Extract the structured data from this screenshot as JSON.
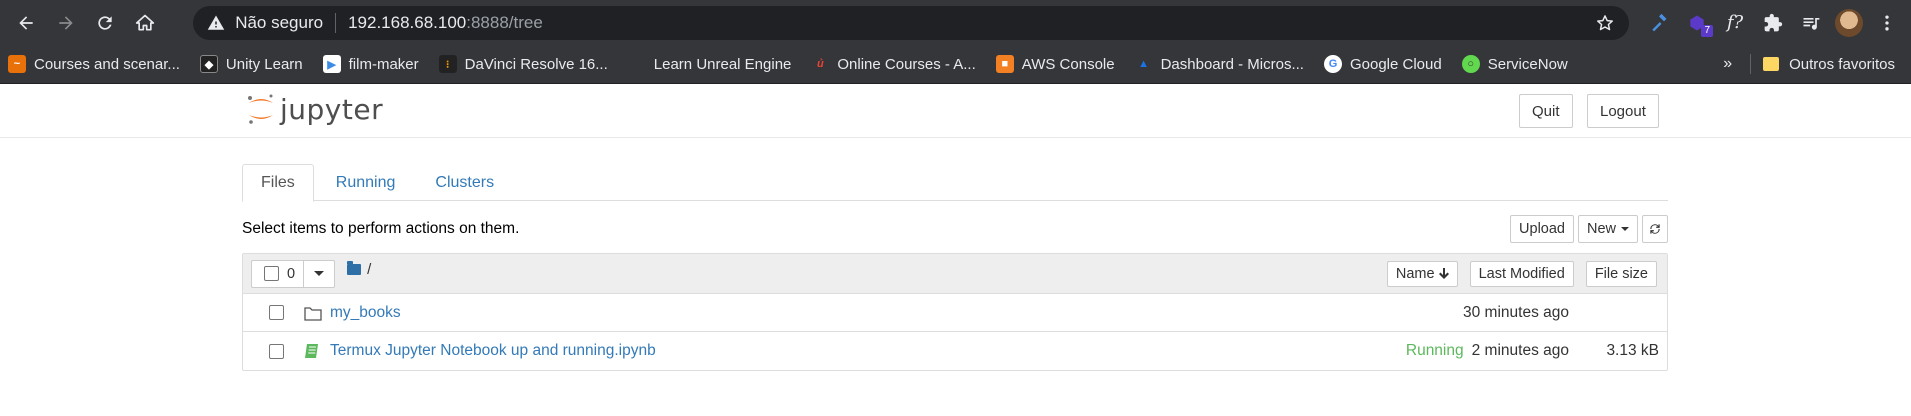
{
  "browser": {
    "security_label": "Não seguro",
    "url_host": "192.168.68.100",
    "url_path": ":8888/tree",
    "extension_badge": "7",
    "bookmarks": [
      {
        "label": "Courses and scenar...",
        "icon": "courses-icon",
        "color": "#e8710a"
      },
      {
        "label": "Unity Learn",
        "icon": "unity-icon",
        "color": "#222"
      },
      {
        "label": "film-maker",
        "icon": "film-icon",
        "color": "#3c8ce7"
      },
      {
        "label": "DaVinci Resolve 16...",
        "icon": "davinci-icon",
        "color": "#f29900"
      },
      {
        "label": "Learn Unreal Engine",
        "icon": "unreal-icon",
        "color": "#35363a"
      },
      {
        "label": "Online Courses - A...",
        "icon": "udemy-icon",
        "color": "#ea4335"
      },
      {
        "label": "AWS Console",
        "icon": "aws-icon",
        "color": "#f48024"
      },
      {
        "label": "Dashboard - Micros...",
        "icon": "azure-icon",
        "color": "#1a73e8"
      },
      {
        "label": "Google Cloud",
        "icon": "google-icon",
        "color": "#fff"
      },
      {
        "label": "ServiceNow",
        "icon": "servicenow-icon",
        "color": "#62d84e"
      }
    ],
    "more_label": "»",
    "other_bookmarks": "Outros favoritos"
  },
  "jupyter": {
    "logo_text": "jupyter",
    "quit_label": "Quit",
    "logout_label": "Logout",
    "tabs": [
      {
        "label": "Files",
        "active": true
      },
      {
        "label": "Running",
        "active": false
      },
      {
        "label": "Clusters",
        "active": false
      }
    ],
    "hint": "Select items to perform actions on them.",
    "upload_label": "Upload",
    "new_label": "New",
    "selected_count": "0",
    "breadcrumb": "/",
    "columns": {
      "name": "Name",
      "last_modified": "Last Modified",
      "file_size": "File size"
    },
    "items": [
      {
        "name": "my_books",
        "type": "folder",
        "status": "",
        "modified": "30 minutes ago",
        "size": ""
      },
      {
        "name": "Termux Jupyter Notebook up and running.ipynb",
        "type": "notebook",
        "status": "Running",
        "modified": "2 minutes ago",
        "size": "3.13 kB"
      }
    ]
  }
}
